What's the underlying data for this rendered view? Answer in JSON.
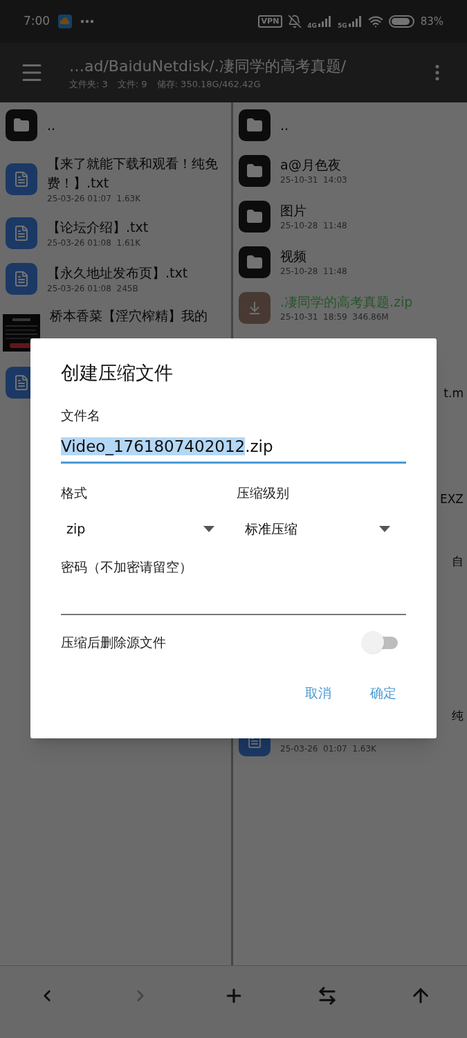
{
  "status_bar": {
    "time": "7:00",
    "vpn": "VPN",
    "network_1": "4G",
    "network_2": "5G",
    "battery": "83%"
  },
  "toolbar": {
    "path": "…ad/BaiduNetdisk/.凄同学的高考真题/",
    "stats": [
      "文件夹: 3",
      "文件: 9",
      "储存: 350.18G/462.42G"
    ]
  },
  "left_panel": {
    "items": [
      {
        "kind": "folder",
        "name": ".."
      },
      {
        "kind": "text_file",
        "name": "【来了就能下载和观看！纯免费！】.txt",
        "meta": "25-03-26 01:07  1.63K"
      },
      {
        "kind": "text_file",
        "name": "【论坛介绍】.txt",
        "meta": "25-03-26 01:08  1.61K"
      },
      {
        "kind": "text_file",
        "name": "【永久地址发布页】.txt",
        "meta": "25-03-26 01:08  245B"
      },
      {
        "kind": "picture",
        "name": "桥本香菜【淫穴榨精】我的"
      },
      {
        "kind": "text_file"
      }
    ]
  },
  "right_panel": {
    "items": [
      {
        "kind": "folder",
        "name": "..",
        "highlighted": false
      },
      {
        "kind": "folder",
        "name": "a@月色夜",
        "meta": "25-10-31  14:03",
        "highlighted": false
      },
      {
        "kind": "folder",
        "name": "图片",
        "meta": "25-10-28  11:48",
        "highlighted": false
      },
      {
        "kind": "folder",
        "name": "视频",
        "meta": "25-10-28  11:48",
        "highlighted": false
      },
      {
        "kind": "archive",
        "name": ".凄同学的高考真题.zip",
        "meta": "25-10-31  18:59  346.86M",
        "highlighted": true
      }
    ],
    "fragments": [
      "t.m",
      "EXZ",
      "自",
      "纯"
    ],
    "partial_item": {
      "kind": "text_file",
      "meta": "25-03-26  01:07  1.63K"
    }
  },
  "dialog": {
    "title": "创建压缩文件",
    "filename_label": "文件名",
    "filename": {
      "selected_text": "Video_1761807402012",
      "rest_text": ".zip"
    },
    "format": {
      "label": "格式",
      "value": "zip"
    },
    "level": {
      "label": "压缩级别",
      "value": "标准压缩"
    },
    "password": {
      "label": "密码（不加密请留空）"
    },
    "delete_source": {
      "label": "压缩后删除源文件",
      "on": false
    },
    "buttons": [
      "取消",
      "确定"
    ]
  },
  "bottom_bar": [
    {
      "kind": "back",
      "disabled": false
    },
    {
      "kind": "forward",
      "disabled": true
    },
    {
      "kind": "add",
      "disabled": false
    },
    {
      "kind": "swap",
      "disabled": false
    },
    {
      "kind": "up",
      "disabled": false
    }
  ]
}
